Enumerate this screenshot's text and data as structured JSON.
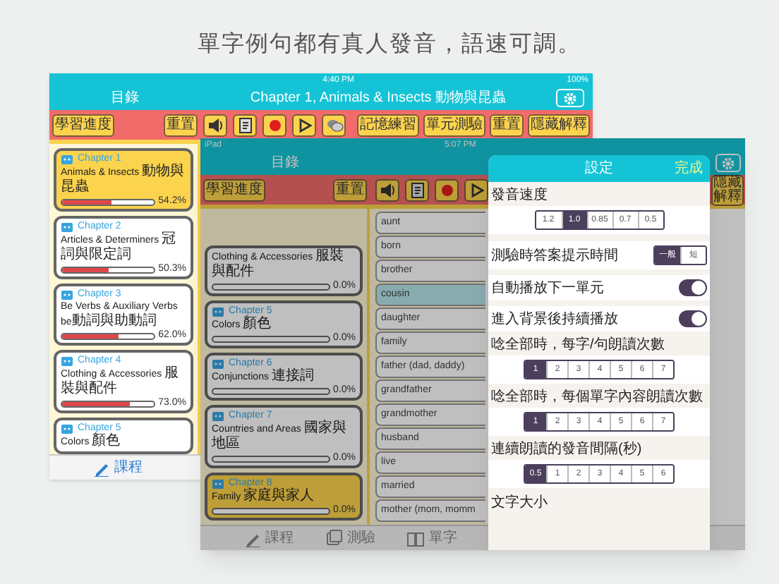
{
  "caption": "單字例句都有真人發音，語速可調。",
  "back_screen": {
    "status_bar": {
      "time": "4:40 PM",
      "battery": "100%"
    },
    "sidebar_title": "目錄",
    "title": "Chapter 1, Animals & Insects 動物與昆蟲",
    "toolbar_left": [
      "學習進度",
      "重置"
    ],
    "toolbar_right": [
      "記憶練習",
      "單元測驗",
      "重置",
      "隱藏解釋"
    ],
    "chapters": [
      {
        "label": "Chapter 1",
        "title": "Animals & Insects 動物與昆蟲",
        "level": 0.542,
        "reading": "54.2%",
        "selected": true
      },
      {
        "label": "Chapter 2",
        "title": "Articles & Determiners 冠詞與限定詞",
        "level": 0.503,
        "reading": "50.3%",
        "selected": false
      },
      {
        "label": "Chapter 3",
        "title": "Be Verbs & Auxiliary Verbs be動詞與助動詞",
        "level": 0.62,
        "reading": "62.0%",
        "selected": false
      },
      {
        "label": "Chapter 4",
        "title": "Clothing & Accessories 服裝與配件",
        "level": 0.73,
        "reading": "73.0%",
        "selected": false
      },
      {
        "label": "Chapter 5",
        "title": "Colors 顏色",
        "selected": false
      }
    ],
    "tabs": [
      {
        "label": "課程",
        "selected": true
      }
    ]
  },
  "front_screen": {
    "status_bar": {
      "device": "iPad",
      "time": "5:07 PM"
    },
    "sidebar_title": "目錄",
    "toolbar_left": [
      "學習進度",
      "重置"
    ],
    "toolbar_right": [
      "隱藏解釋"
    ],
    "chapters": [
      {
        "title": "Clothing & Accessories 服裝與配件",
        "level": 0,
        "reading": "0.0%",
        "selected": false
      },
      {
        "label": "Chapter 5",
        "title": "Colors 顏色",
        "level": 0,
        "reading": "0.0%",
        "selected": false
      },
      {
        "label": "Chapter 6",
        "title": "Conjunctions 連接詞",
        "level": 0,
        "reading": "0.0%",
        "selected": false
      },
      {
        "label": "Chapter 7",
        "title": "Countries and Areas 國家與地區",
        "level": 0,
        "reading": "0.0%",
        "selected": false
      },
      {
        "label": "Chapter 8",
        "title": "Family 家庭與家人",
        "level": 0,
        "reading": "0.0%",
        "selected": true
      }
    ],
    "words": [
      {
        "text": "aunt",
        "selected": false
      },
      {
        "text": "born",
        "selected": false
      },
      {
        "text": "brother",
        "selected": false
      },
      {
        "text": "cousin",
        "selected": true
      },
      {
        "text": "daughter",
        "selected": false
      },
      {
        "text": "family",
        "selected": false
      },
      {
        "text": "father (dad, daddy)",
        "selected": false
      },
      {
        "text": "grandfather",
        "selected": false
      },
      {
        "text": "grandmother",
        "selected": false
      },
      {
        "text": "husband",
        "selected": false
      },
      {
        "text": "live",
        "selected": false
      },
      {
        "text": "married",
        "selected": false
      },
      {
        "text": "mother (mom, momm",
        "selected": false
      }
    ],
    "tabs": [
      {
        "label": "課程",
        "selected": false
      },
      {
        "label": "測驗",
        "selected": false
      },
      {
        "label": "單字",
        "selected": false
      }
    ],
    "settings": {
      "title": "設定",
      "done": "完成",
      "rows": [
        {
          "kind": "segmented",
          "label": "發音速度",
          "options": [
            {
              "label": "1.2",
              "selected": false
            },
            {
              "label": "1.0",
              "selected": true
            },
            {
              "label": "0.85",
              "selected": false
            },
            {
              "label": "0.7",
              "selected": false
            },
            {
              "label": "0.5",
              "selected": false
            }
          ]
        },
        {
          "kind": "inline",
          "label": "測驗時答案提示時間",
          "options": [
            {
              "label": "一般",
              "selected": true
            },
            {
              "label": "短",
              "selected": false
            }
          ]
        },
        {
          "kind": "toggle",
          "label": "自動播放下一單元",
          "on": true
        },
        {
          "kind": "toggle",
          "label": "進入背景後持續播放",
          "on": true
        },
        {
          "kind": "segmented",
          "label": "唸全部時，每字/句朗讀次數",
          "options": [
            {
              "label": "1",
              "selected": true
            },
            {
              "label": "2",
              "selected": false
            },
            {
              "label": "3",
              "selected": false
            },
            {
              "label": "4",
              "selected": false
            },
            {
              "label": "5",
              "selected": false
            },
            {
              "label": "6",
              "selected": false
            },
            {
              "label": "7",
              "selected": false
            }
          ]
        },
        {
          "kind": "segmented",
          "label": "唸全部時，每個單字內容朗讀次數",
          "options": [
            {
              "label": "1",
              "selected": true
            },
            {
              "label": "2",
              "selected": false
            },
            {
              "label": "3",
              "selected": false
            },
            {
              "label": "4",
              "selected": false
            },
            {
              "label": "5",
              "selected": false
            },
            {
              "label": "6",
              "selected": false
            },
            {
              "label": "7",
              "selected": false
            }
          ]
        },
        {
          "kind": "segmented",
          "label": "連續朗讀的發音間隔(秒)",
          "options": [
            {
              "label": "0.5",
              "selected": true
            },
            {
              "label": "1",
              "selected": false
            },
            {
              "label": "2",
              "selected": false
            },
            {
              "label": "3",
              "selected": false
            },
            {
              "label": "4",
              "selected": false
            },
            {
              "label": "5",
              "selected": false
            },
            {
              "label": "6",
              "selected": false
            }
          ]
        },
        {
          "kind": "header",
          "label": "文字大小"
        }
      ]
    }
  }
}
